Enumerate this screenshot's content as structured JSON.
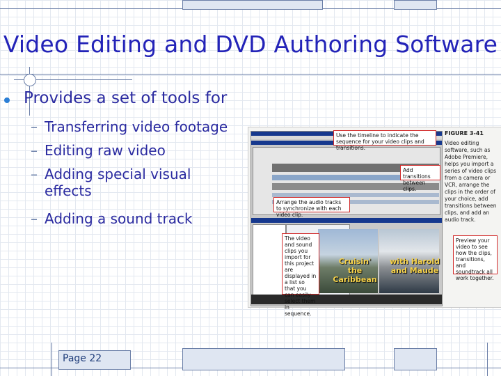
{
  "slide": {
    "title": "Video Editing and DVD Authoring Software",
    "bullet": "Provides a set of tools for",
    "subpoints": [
      {
        "label": "Transferring video footage"
      },
      {
        "label": "Editing raw video"
      },
      {
        "label": "Adding special visual effects"
      },
      {
        "label": "Adding a sound track"
      }
    ],
    "footer_label": "Page 22"
  },
  "figure": {
    "heading": "FIGURE 3-41",
    "caption": "Video editing software, such as Adobe Premiere, helps you import a series of video clips from a camera or VCR, arrange the clips in the order of your choice, add transitions between clips, and add an audio track.",
    "callouts": {
      "timeline": "Use the timeline to indicate the sequence for your video clips and transitions.",
      "transitions": "Add transitions between clips.",
      "audio": "Arrange the audio tracks to synchronize with each video clip.",
      "clips": "The video and sound clips you import for this project are displayed in a list so that you can easily select them in sequence.",
      "preview": "Preview your video to see how the clips, transitions, and soundtrack all work together."
    },
    "photo_labels": {
      "left": "Cruisin' the Caribbean",
      "right": "with Harold and Maude"
    }
  },
  "colors": {
    "title": "#2323b8",
    "bullet": "#2b7fd6",
    "callout_border": "#d22b2b"
  }
}
